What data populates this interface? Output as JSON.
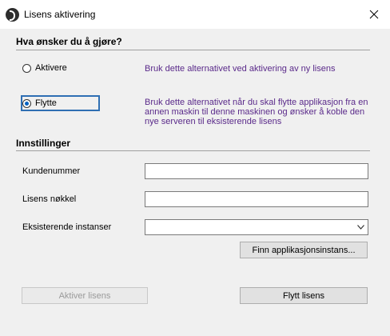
{
  "window": {
    "title": "Lisens aktivering"
  },
  "action_section": {
    "heading": "Hva ønsker du å gjøre?",
    "options": [
      {
        "label": "Aktivere",
        "selected": false,
        "description": "Bruk dette alternativet ved aktivering av ny lisens"
      },
      {
        "label": "Flytte",
        "selected": true,
        "description": "Bruk dette alternativet når du skal flytte applikasjon fra en annen maskin til denne maskinen og ønsker å koble den nye serveren til eksisterende lisens"
      }
    ]
  },
  "settings_section": {
    "heading": "Innstillinger",
    "customer_number_label": "Kundenummer",
    "customer_number_value": "",
    "license_key_label": "Lisens nøkkel",
    "license_key_value": "",
    "instances_label": "Eksisterende instanser",
    "instances_value": "",
    "find_button": "Finn applikasjonsinstans..."
  },
  "footer": {
    "activate_button": "Aktiver lisens",
    "move_button": "Flytt lisens"
  },
  "colors": {
    "description_text": "#5a2a8a",
    "radio_selected": "#0060c0"
  }
}
